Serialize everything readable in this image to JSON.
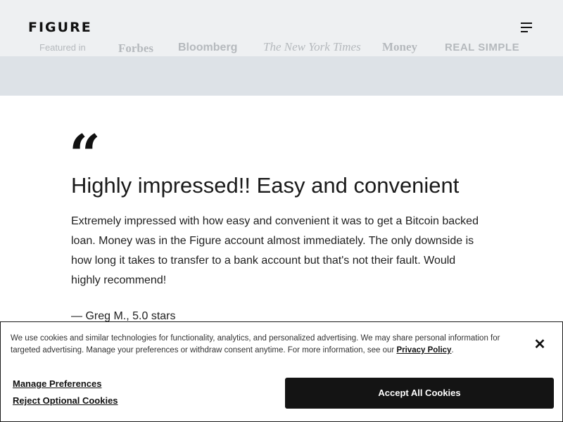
{
  "header": {
    "logo": "FIGURE",
    "menu_icon": "hamburger-menu-icon"
  },
  "featured": {
    "label": "Featured in",
    "brands": [
      "Forbes",
      "Bloomberg",
      "The New York Times",
      "Money",
      "REAL SIMPLE"
    ]
  },
  "testimonial": {
    "quote_mark": "“",
    "headline": "Highly impressed!! Easy and convenient",
    "body": "Extremely impressed with how easy and convenient it was to get a Bitcoin backed loan. Money was in the Figure account almost immediately. The only downside is how long it takes to transfer to a bank account but that's not their fault. Would highly recommend!",
    "attribution": "— Greg M., 5.0 stars"
  },
  "cookie_banner": {
    "text": "We use cookies and similar technologies for functionality, analytics, and personalized advertising. We may share personal information for targeted advertising. Manage your preferences or withdraw consent anytime. For more information, see our",
    "policy_link": "Privacy Policy",
    "text_end": ".",
    "close_icon": "close-icon",
    "manage_label": "Manage Preferences",
    "reject_label": "Reject Optional Cookies",
    "accept_label": "Accept All Cookies"
  }
}
